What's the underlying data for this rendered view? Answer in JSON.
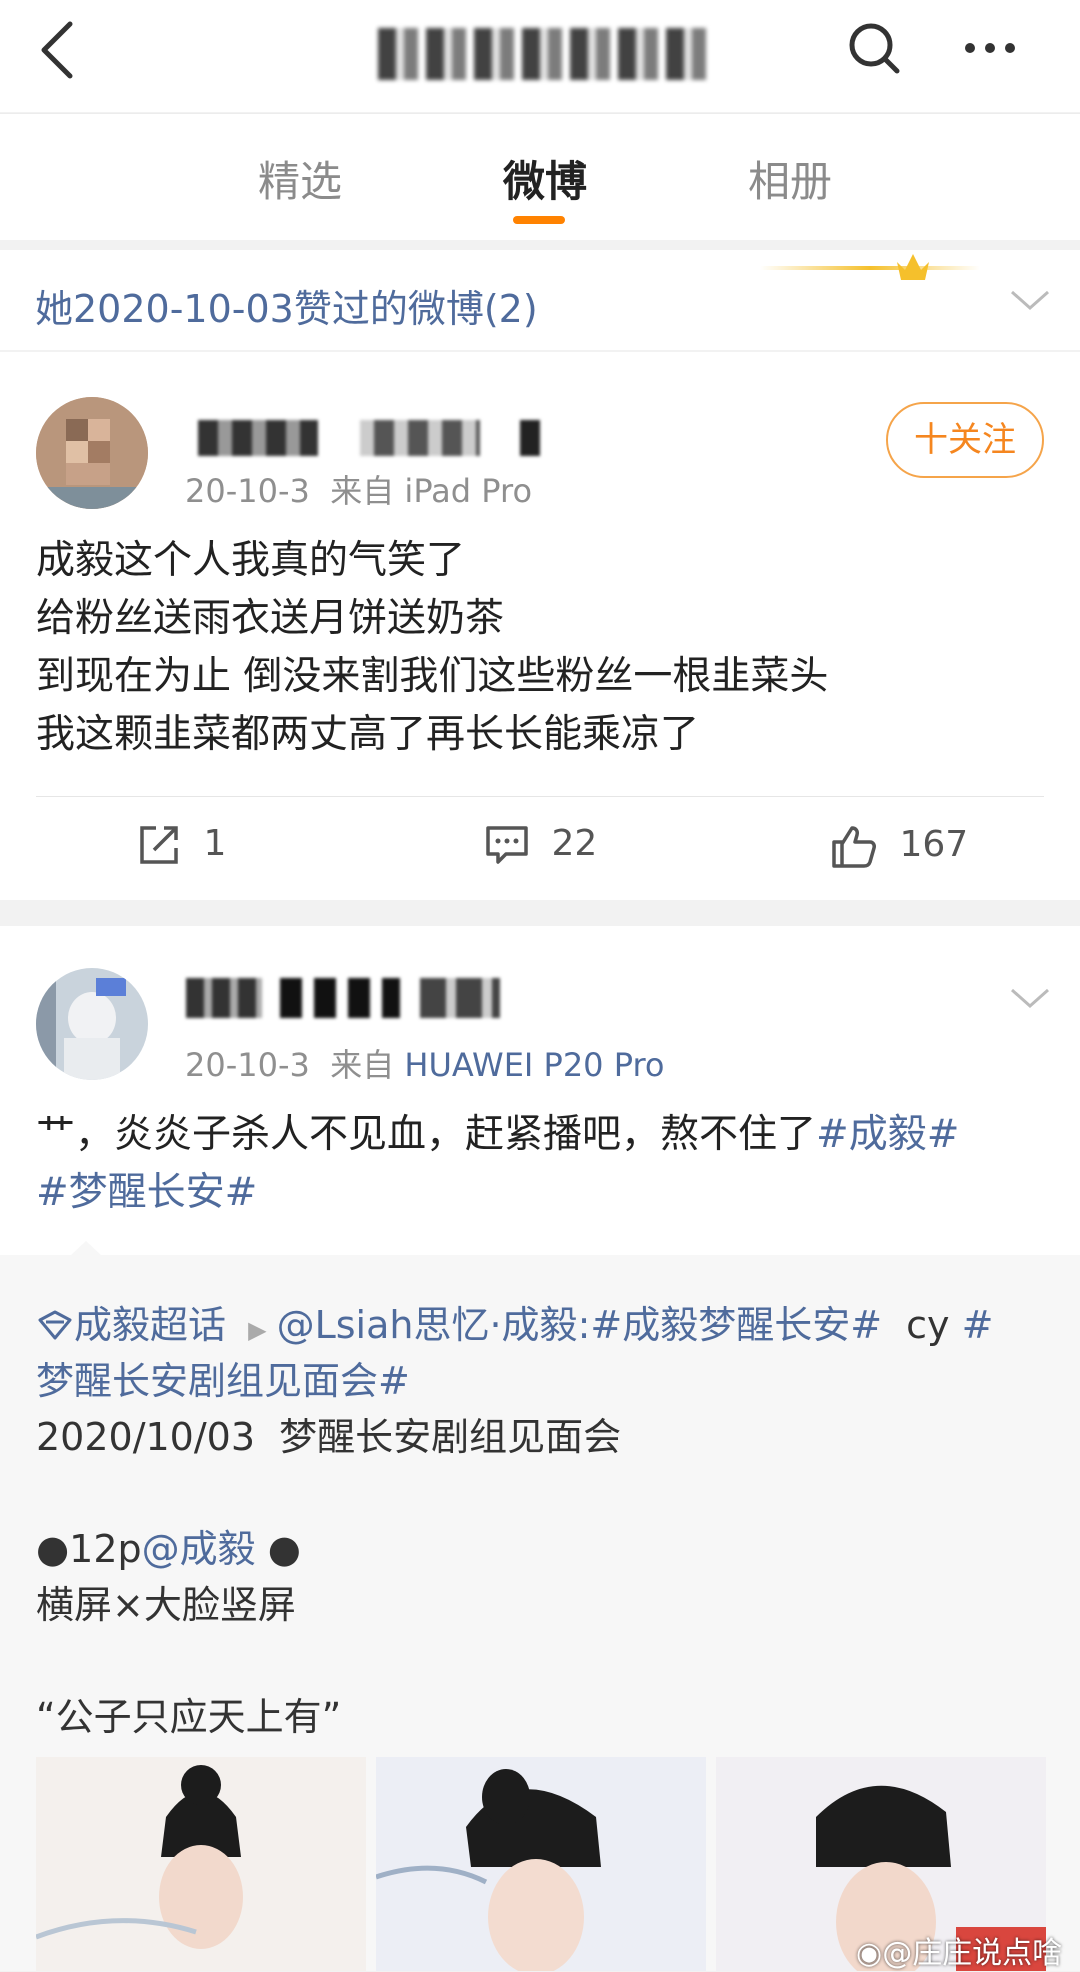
{
  "header": {
    "title_blurred": true
  },
  "tabs": [
    {
      "label": "精选"
    },
    {
      "label": "微博"
    },
    {
      "label": "相册"
    }
  ],
  "liked": {
    "text": "她2020-10-03赞过的微博(2)"
  },
  "post1": {
    "date": "20-10-3",
    "source_prefix": "来自",
    "source": "iPad Pro",
    "follow_label": "十关注",
    "text": "成毅这个人我真的气笑了\n给粉丝送雨衣送月饼送奶茶\n到现在为止 倒没来割我们这些粉丝一根韭菜头\n我这颗韭菜都两丈高了再长长能乘凉了",
    "reposts": "1",
    "comments": "22",
    "likes": "167"
  },
  "post2": {
    "date": "20-10-3",
    "source_prefix": "来自",
    "source": "HUAWEI P20 Pro",
    "text_plain": "艹，炎炎子杀人不见血，赶紧播吧，熬不住了",
    "tag1": "#成毅#",
    "tag2": "#梦醒长安#",
    "repost": {
      "supertopic": "成毅超话",
      "author": "@Lsiah思忆·成毅",
      "tag_main": ":#成毅梦醒长安#",
      "cy": "cy",
      "tag_line2a": "#",
      "tag_line2": "梦醒长安剧组见面会#",
      "line_date": "2020/10/03  梦醒长安剧组见面会",
      "line_12p_a": "●12p",
      "line_12p_mention": "@成毅",
      "line_12p_b": " ●",
      "line_screen": "横屏×大脸竖屏",
      "line_quote": "“公子只应天上有”"
    }
  },
  "watermark": "@庄庄说点啥",
  "colors": {
    "accent_orange": "#ff8200",
    "link_blue": "#4f6b9c",
    "follow_orange": "#f5861f"
  }
}
